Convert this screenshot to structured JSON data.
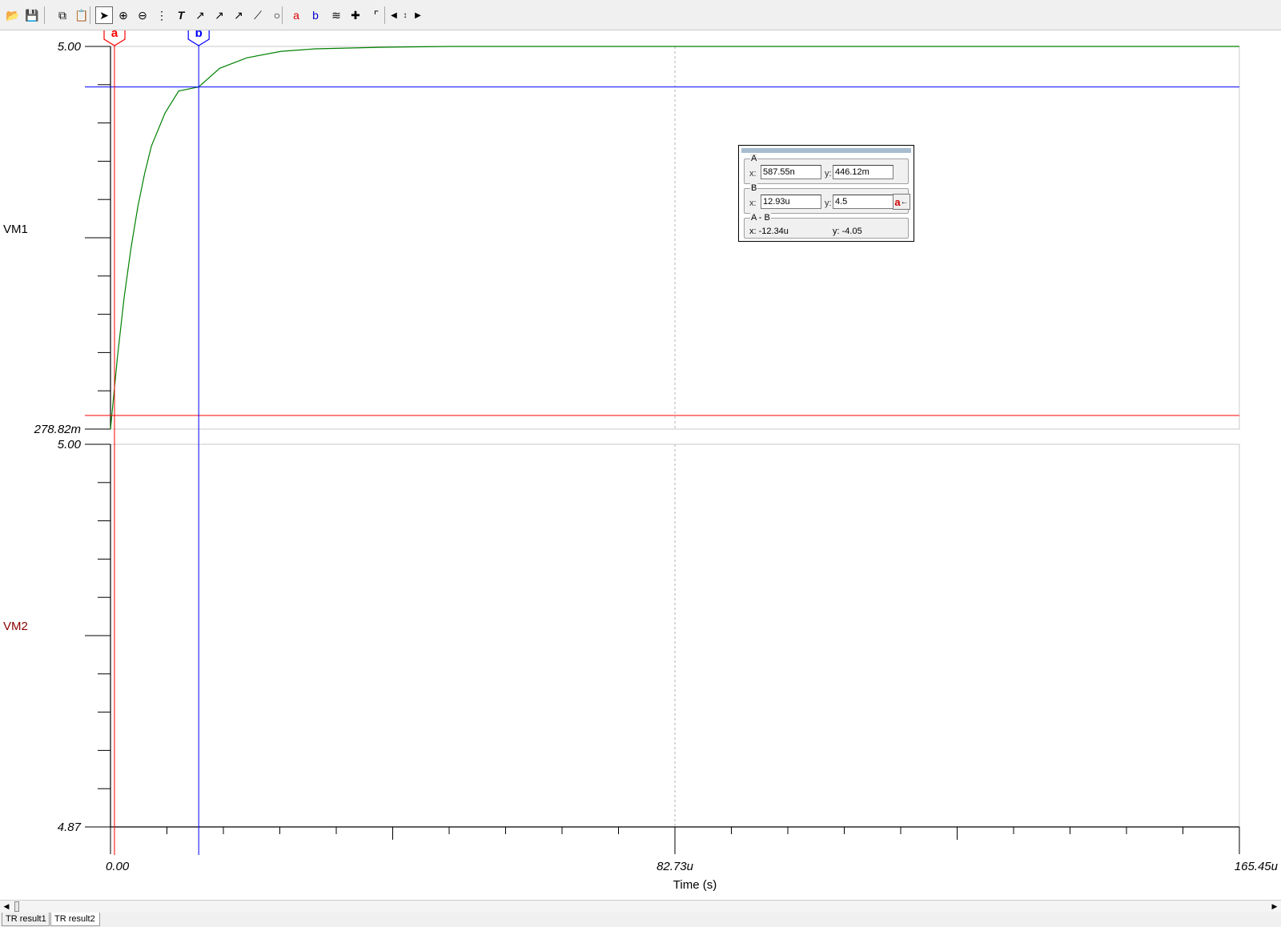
{
  "toolbar": {
    "buttons": [
      "open-icon",
      "save-icon",
      "copy-icon",
      "paste-icon",
      "pointer-icon",
      "zoom-in-icon",
      "zoom-out-icon",
      "grid-icon",
      "text-icon",
      "annotate-curve-icon",
      "annotate-label-icon",
      "annotate-formula-icon",
      "line-icon",
      "circle-icon",
      "cursor-a-icon",
      "cursor-b-icon",
      "add-curve-icon",
      "probe-icon",
      "wire-icon",
      "arrow-left-icon",
      "arrow-up-down-icon",
      "arrow-right-icon"
    ],
    "active": "pointer-icon"
  },
  "chart_data": [
    {
      "type": "line",
      "ylabel": "VM1",
      "ylim_labels": [
        "278.82m",
        "5.00"
      ],
      "ylim": [
        0.27882,
        5.0
      ],
      "series": [
        {
          "name": "VM1",
          "color": "#008000",
          "x_us": [
            0,
            1,
            2,
            3,
            4,
            5,
            6,
            8,
            10,
            12.93,
            16,
            20,
            25,
            30,
            40,
            50,
            60,
            80,
            100,
            120,
            140,
            165.45
          ],
          "y": [
            0.279,
            1.15,
            1.9,
            2.51,
            3.02,
            3.43,
            3.77,
            4.18,
            4.45,
            4.5,
            4.73,
            4.86,
            4.94,
            4.97,
            4.99,
            5.0,
            5.0,
            5.0,
            5.0,
            5.0,
            5.0,
            5.0
          ]
        }
      ]
    },
    {
      "type": "line",
      "ylabel": "VM2",
      "ylim_labels": [
        "4.87",
        "5.00"
      ],
      "ylim": [
        4.87,
        5.0
      ],
      "series": []
    }
  ],
  "xaxis": {
    "label": "Time (s)",
    "ticks": [
      "0.00",
      "82.73u",
      "165.45u"
    ],
    "range_us": [
      0,
      165.45
    ]
  },
  "cursors": {
    "a": {
      "label": "a",
      "color": "#ff0000",
      "x_us": 0.58755,
      "y": 0.44612
    },
    "b": {
      "label": "b",
      "color": "#0000ff",
      "x_us": 12.93,
      "y": 4.5
    }
  },
  "cursor_window": {
    "a_title": "A",
    "a_x_label": "x:",
    "a_x": "587.55n",
    "a_y_label": "y:",
    "a_y": "446.12m",
    "b_title": "B",
    "b_x_label": "x:",
    "b_x": "12.93u",
    "b_y_label": "y:",
    "b_y": "4.5",
    "b_button": "a",
    "diff_title": "A - B",
    "diff_x": "x:  -12.34u",
    "diff_y": "y: -4.05"
  },
  "tabs": [
    "TR result1",
    "TR result2"
  ],
  "selected_tab": 1
}
